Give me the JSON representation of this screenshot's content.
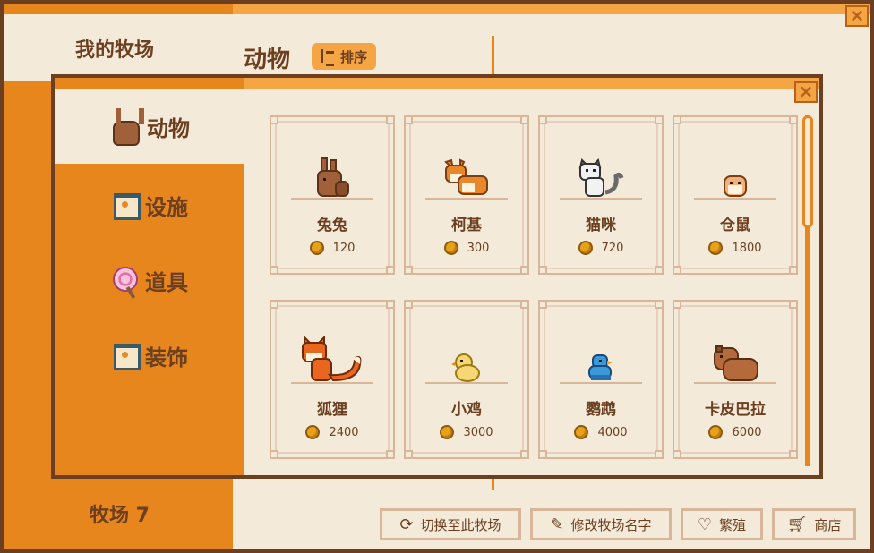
{
  "background": {
    "sidebar_title": "我的牧场",
    "heading": "动物",
    "sort_label": "排序",
    "ranch_label": "牧场 7",
    "buttons": [
      {
        "label": "切换至此牧场",
        "icon": "refresh-icon"
      },
      {
        "label": "修改牧场名字",
        "icon": "pencil-icon"
      },
      {
        "label": "繁殖",
        "icon": "heart-icon"
      },
      {
        "label": "商店",
        "icon": "cart-icon"
      }
    ],
    "close_icon": "×"
  },
  "dialog": {
    "close_icon": "×",
    "tabs": [
      {
        "label": "动物",
        "icon": "rabbit-icon",
        "active": true
      },
      {
        "label": "设施",
        "icon": "house-icon",
        "active": false
      },
      {
        "label": "道具",
        "icon": "lollipop-icon",
        "active": false
      },
      {
        "label": "装饰",
        "icon": "house-icon",
        "active": false
      }
    ],
    "items": [
      {
        "name": "兔兔",
        "price": "120",
        "icon": "rabbit-icon"
      },
      {
        "name": "柯基",
        "price": "300",
        "icon": "corgi-icon"
      },
      {
        "name": "猫咪",
        "price": "720",
        "icon": "cat-icon"
      },
      {
        "name": "仓鼠",
        "price": "1800",
        "icon": "hamster-icon"
      },
      {
        "name": "狐狸",
        "price": "2400",
        "icon": "fox-icon"
      },
      {
        "name": "小鸡",
        "price": "3000",
        "icon": "chick-icon"
      },
      {
        "name": "鹦鹉",
        "price": "4000",
        "icon": "parrot-icon"
      },
      {
        "name": "卡皮巴拉",
        "price": "6000",
        "icon": "capybara-icon"
      }
    ]
  },
  "colors": {
    "orange": "#e8861e",
    "light_orange": "#f6a545",
    "cream": "#f4ead9",
    "brown": "#6b3f1f"
  }
}
